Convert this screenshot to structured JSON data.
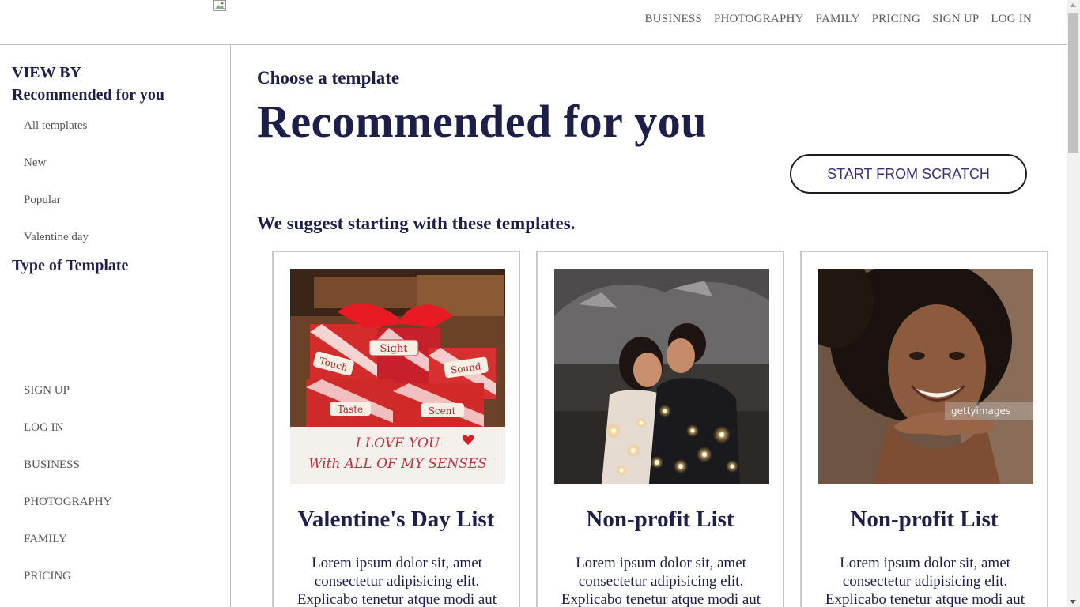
{
  "header": {
    "nav": [
      "BUSINESS",
      "PHOTOGRAPHY",
      "FAMILY",
      "PRICING",
      "SIGN UP",
      "LOG IN"
    ]
  },
  "sidebar": {
    "view_by": "VIEW BY",
    "recommended": "Recommended for you",
    "filters": [
      "All templates",
      "New",
      "Popular",
      "Valentine day"
    ],
    "type_heading": "Type of Template",
    "links": [
      "SIGN UP",
      "LOG IN",
      "BUSINESS",
      "PHOTOGRAPHY",
      "FAMILY",
      "PRICING"
    ]
  },
  "main": {
    "pre_title": "Choose a template",
    "title": "Recommended for you",
    "scratch_button": "START FROM SCRATCH",
    "suggest": "We suggest starting with these templates."
  },
  "cards": [
    {
      "title": "Valentine's Day List",
      "desc": "Lorem ipsum dolor sit, amet consectetur adipisicing elit. Explicabo tenetur atque modi aut",
      "image": "valentine-gifts-photo"
    },
    {
      "title": "Non-profit List",
      "desc": "Lorem ipsum dolor sit, amet consectetur adipisicing elit. Explicabo tenetur atque modi aut",
      "image": "couple-lights-photo"
    },
    {
      "title": "Non-profit List",
      "desc": "Lorem ipsum dolor sit, amet consectetur adipisicing elit. Explicabo tenetur atque modi aut",
      "image": "smiling-woman-photo"
    }
  ],
  "photo_text": {
    "sight": "Sight",
    "touch": "Touch",
    "sound": "Sound",
    "taste": "Taste",
    "scent": "Scent",
    "love_line1": "I LOVE YOU",
    "love_line2": "With ALL OF MY SENSES",
    "watermark": "gettyimages"
  },
  "colors": {
    "heading": "#1c1f4a",
    "nav_text": "#5a5a5a",
    "button_text": "#3c2d7a",
    "border": "#c9c9c9"
  }
}
